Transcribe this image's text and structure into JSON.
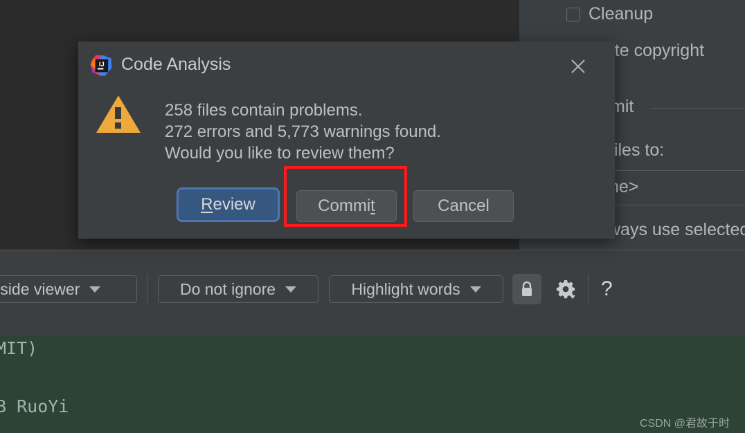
{
  "dialog": {
    "title": "Code Analysis",
    "app_icon": "intellij-idea-logo",
    "warning_icon": "warning-triangle-icon",
    "close_icon": "close-icon",
    "message_lines": [
      "258 files contain problems.",
      "272 errors and 5,773 warnings found.",
      "Would you like to review them?"
    ],
    "buttons": {
      "review": {
        "label": "Review",
        "mnemonic": "R",
        "primary": true
      },
      "commit": {
        "label": "Commit",
        "mnemonic": "t",
        "primary": false
      },
      "cancel": {
        "label": "Cancel",
        "mnemonic": "",
        "primary": false
      }
    },
    "highlight_color": "#ff1a1a",
    "highlighted_button": "Commit"
  },
  "background_panel": {
    "checkbox_cleanup": "Cleanup",
    "checkbox_update_copyright": "date copyright",
    "section_commit": "mit",
    "label_files_to": "files to:",
    "combo_value": "ne>",
    "checkbox_always_use_selected": "ways use selected"
  },
  "toolbar": {
    "viewer_dropdown": "-side viewer",
    "ignore_dropdown": "Do not ignore",
    "highlight_dropdown": "Highlight words",
    "lock_icon": "lock-icon",
    "settings_icon": "gear-icon",
    "help_icon": "help-question-icon"
  },
  "editor": {
    "lines": [
      "MIT)",
      "B RuoYi"
    ],
    "background_color": "#2c4336"
  },
  "watermark": "CSDN @君故于时"
}
